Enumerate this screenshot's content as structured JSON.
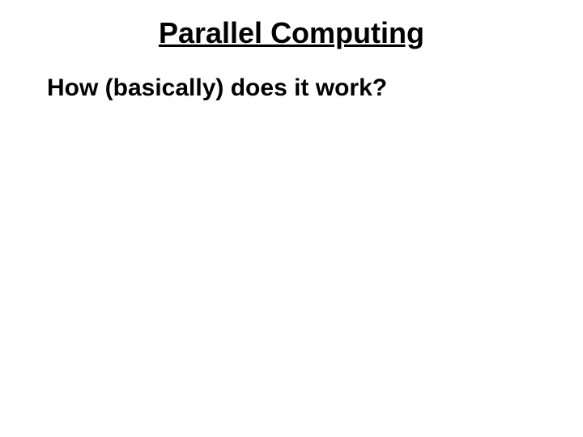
{
  "slide": {
    "title": "Parallel Computing",
    "subtitle": "How (basically) does it work?"
  }
}
